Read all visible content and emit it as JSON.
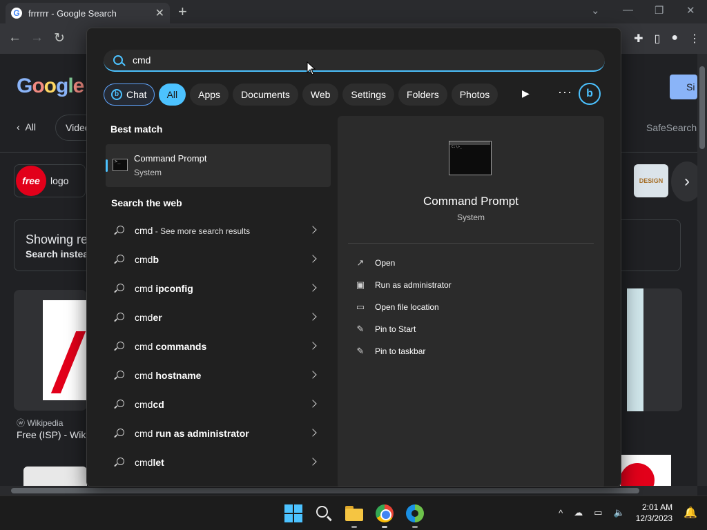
{
  "browser": {
    "tab_title": "frrrrrr - Google Search",
    "tab_close": "✕",
    "new_tab": "+"
  },
  "google": {
    "logo": [
      "G",
      "o",
      "o",
      "g",
      "l",
      "e"
    ],
    "nav_all": "All",
    "nav_videos": "Videos",
    "safesearch": "SafeSearch",
    "chip_logo": "logo",
    "chip_free_mark": "free",
    "chip_design": "DESIGN",
    "showing_line1": "Showing results for",
    "showing_line2": "Search instead for",
    "wiki_source": "Wikipedia",
    "wiki_title": "Free (ISP) - Wikipedia",
    "signin": "Si"
  },
  "search_panel": {
    "query": "cmd",
    "filters": [
      {
        "label": "Chat",
        "kind": "chat"
      },
      {
        "label": "All",
        "kind": "active"
      },
      {
        "label": "Apps",
        "kind": ""
      },
      {
        "label": "Documents",
        "kind": ""
      },
      {
        "label": "Web",
        "kind": ""
      },
      {
        "label": "Settings",
        "kind": ""
      },
      {
        "label": "Folders",
        "kind": ""
      },
      {
        "label": "Photos",
        "kind": ""
      }
    ],
    "play_glyph": "▶",
    "more_glyph": "···",
    "bing_glyph": "b",
    "best_match_heading": "Best match",
    "best_match": {
      "name": "Command Prompt",
      "subtitle": "System"
    },
    "web_heading": "Search the web",
    "web_results": [
      {
        "pre": "cmd",
        "bold": "",
        "small": " - See more search results"
      },
      {
        "pre": "cmd",
        "bold": "b",
        "small": ""
      },
      {
        "pre": "cmd ",
        "bold": "ipconfig",
        "small": ""
      },
      {
        "pre": "cmd",
        "bold": "er",
        "small": ""
      },
      {
        "pre": "cmd ",
        "bold": "commands",
        "small": ""
      },
      {
        "pre": "cmd ",
        "bold": "hostname",
        "small": ""
      },
      {
        "pre": "cmd",
        "bold": "cd",
        "small": ""
      },
      {
        "pre": "cmd ",
        "bold": "run as administrator",
        "small": ""
      },
      {
        "pre": "cmd",
        "bold": "let",
        "small": ""
      }
    ],
    "detail": {
      "name": "Command Prompt",
      "subtitle": "System",
      "actions": [
        {
          "label": "Open",
          "icon": "open-icon",
          "glyph": "↗"
        },
        {
          "label": "Run as administrator",
          "icon": "shield-icon",
          "glyph": "▣"
        },
        {
          "label": "Open file location",
          "icon": "folder-icon",
          "glyph": "▭"
        },
        {
          "label": "Pin to Start",
          "icon": "pin-icon",
          "glyph": "✎"
        },
        {
          "label": "Pin to taskbar",
          "icon": "pin-icon",
          "glyph": "✎"
        }
      ]
    }
  },
  "taskbar": {
    "time": "2:01 AM",
    "date": "12/3/2023",
    "tray_chevron": "^"
  },
  "colors": {
    "accent": "#4cc2ff",
    "panel_bg": "#202020",
    "chrome_bg": "#202124"
  }
}
